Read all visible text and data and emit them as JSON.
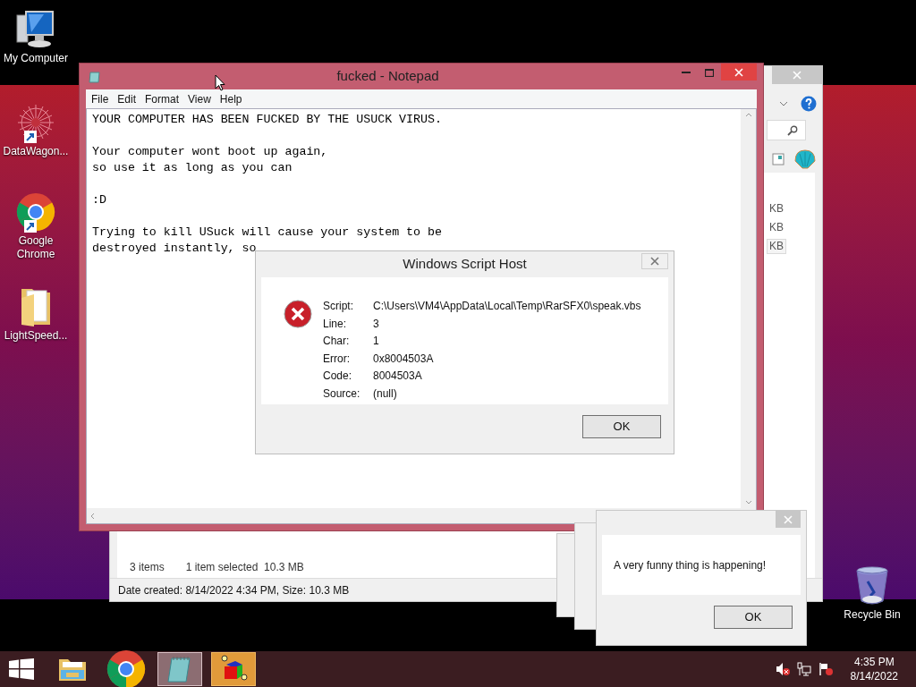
{
  "desktop_icons": [
    {
      "label": "My Computer",
      "kind": "computer",
      "shortcut": false
    },
    {
      "label": "DataWagon...",
      "kind": "starburst",
      "shortcut": true
    },
    {
      "label": "Google Chrome",
      "kind": "chrome",
      "shortcut": true
    },
    {
      "label": "LightSpeed...",
      "kind": "folder",
      "shortcut": false
    },
    {
      "label": "Recycle Bin",
      "kind": "recycle",
      "shortcut": false
    }
  ],
  "explorer": {
    "size_cells": [
      {
        "text": "KB",
        "selected": false
      },
      {
        "text": "KB",
        "selected": false
      },
      {
        "text": "KB",
        "selected": true
      }
    ],
    "item_count": "3 items",
    "selection": "1 item selected  10.3 MB",
    "details": "Date created: 8/14/2022 4:34 PM, Size: 10.3 MB"
  },
  "notepad": {
    "title": "fucked - Notepad",
    "menu": [
      "File",
      "Edit",
      "Format",
      "View",
      "Help"
    ],
    "paragraphs": [
      [
        "YOUR COMPUTER HAS BEEN FUCKED BY THE USUCK VIRUS."
      ],
      [
        "Your computer wont boot up again,",
        "so use it as long as you can"
      ],
      [
        ":D"
      ],
      [
        "Trying to kill USuck will cause your system to be",
        "destroyed instantly, so"
      ]
    ]
  },
  "script_host": {
    "title": "Windows Script Host",
    "rows": [
      {
        "label": "Script:",
        "value": "C:\\Users\\VM4\\AppData\\Local\\Temp\\RarSFX0\\speak.vbs"
      },
      {
        "label": "Line:",
        "value": "3"
      },
      {
        "label": "Char:",
        "value": "1"
      },
      {
        "label": "Error:",
        "value": "0x8004503A"
      },
      {
        "label": "Code:",
        "value": "8004503A"
      },
      {
        "label": "Source:",
        "value": "(null)"
      }
    ],
    "button": "OK"
  },
  "message_boxes": [
    {
      "text": "A very funny thing is happening!",
      "button": "OK"
    }
  ],
  "taskbar": {
    "apps": [
      {
        "kind": "explorer",
        "active": false,
        "attention": false
      },
      {
        "kind": "chrome",
        "active": false,
        "attention": false
      },
      {
        "kind": "notepad",
        "active": true,
        "attention": false
      },
      {
        "kind": "cube",
        "active": false,
        "attention": true
      }
    ],
    "time": "4:35 PM",
    "date": "8/14/2022"
  }
}
